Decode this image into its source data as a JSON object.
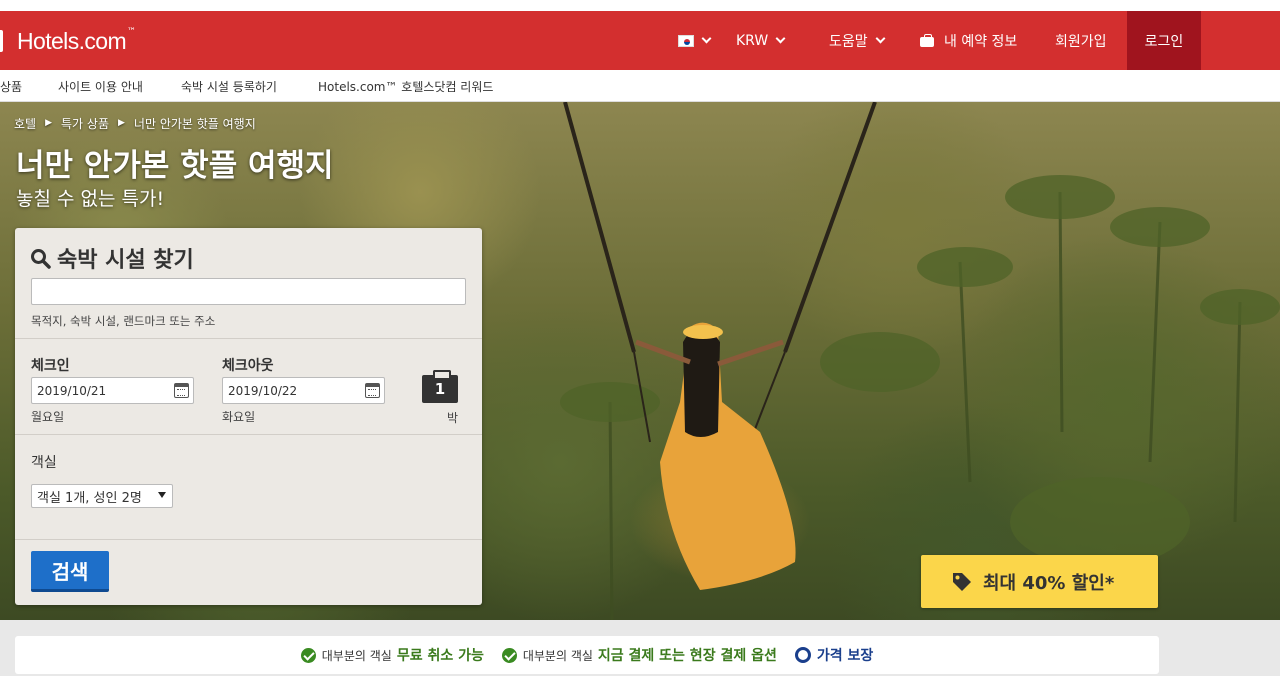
{
  "header": {
    "logo_text": "Hotels.com",
    "logo_tm": "™",
    "currency": "KRW",
    "help": "도움말",
    "my_bookings": "내 예약 정보",
    "signup": "회원가입",
    "login": "로그인"
  },
  "subnav": {
    "items": [
      "상품",
      "사이트 이용 안내",
      "숙박 시설 등록하기",
      "Hotels.com™ 호텔스닷컴 리워드"
    ]
  },
  "hero": {
    "breadcrumb": [
      "호텔",
      "특가 상품",
      "너만 안가본 핫플 여행지"
    ],
    "title": "너만 안가본 핫플 여행지",
    "subtitle": "놓칠 수 없는 특가!"
  },
  "search": {
    "title": "숙박 시설 찾기",
    "destination_value": "",
    "destination_hint": "목적지, 숙박 시설, 랜드마크 또는 주소",
    "checkin_label": "체크인",
    "checkin_value": "2019/10/21",
    "checkin_weekday": "월요일",
    "checkout_label": "체크아웃",
    "checkout_value": "2019/10/22",
    "checkout_weekday": "화요일",
    "nights": "1",
    "nights_unit": "박",
    "rooms_label": "객실",
    "rooms_value": "객실 1개, 성인 2명",
    "button": "검색"
  },
  "promo": {
    "text": "최대 40% 할인*"
  },
  "benefits": {
    "b1_prefix": "대부분의 객실",
    "b1_strong": "무료 취소 가능",
    "b2_prefix": "대부분의 객실",
    "b2_strong": "지금 결제 또는 현장 결제 옵션",
    "b3_strong": "가격 보장"
  },
  "colors": {
    "header_red": "#d32f2f",
    "login_bg": "#a0141e",
    "search_button": "#1e6fc9",
    "promo_yellow": "#fbd64a",
    "benefit_green": "#3a7a1c"
  }
}
